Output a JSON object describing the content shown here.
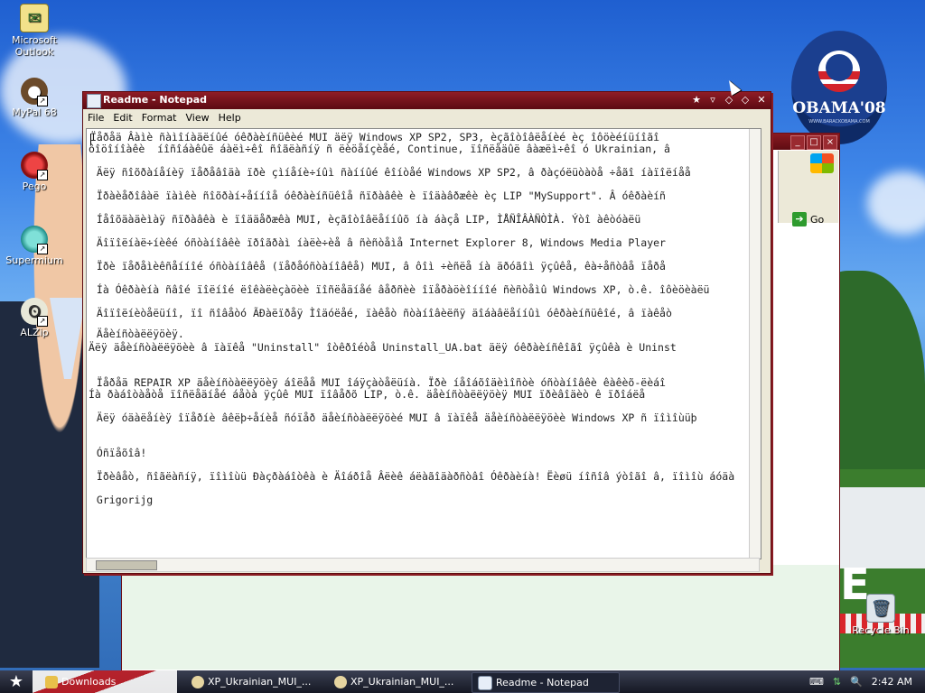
{
  "desktop": {
    "icons": [
      {
        "label_line1": "Microsoft",
        "label_line2": "Outlook"
      },
      {
        "label_line1": "MyPal 68",
        "label_line2": ""
      },
      {
        "label_line1": "Pego",
        "label_line2": ""
      },
      {
        "label_line1": "Supermium",
        "label_line2": ""
      },
      {
        "label_line1": "ALZip",
        "label_line2": ""
      }
    ],
    "recycle_bin": "Recycle Bin",
    "poster": {
      "text": "OBAMA'08",
      "subtitle": "WWW.BARACKOBAMA.COM"
    }
  },
  "notepad": {
    "title": "Readme - Notepad",
    "menu": [
      "File",
      "Edit",
      "Format",
      "View",
      "Help"
    ],
    "lines": [
      "Ïåðåä Âàìè ñàìîíàäëíûé óêðàèíñüêèé MUI äëÿ Windows XP SP2, SP3, èçãîòîâëåíèé èç îôöèéíüíîãî",
      "ôîöîíîàêè  íîñîáàêûë áàëì÷êî ñîãëàñíÿ ñ ëèöåíçèåé, Continue, ïîñëåäûë âàæëì÷êî ó Ukrainian, â",
      " Äëÿ ñîõðàíåíèÿ ïåðåâîäà ïðè çìíåíè÷íûì ñàííûé êîíòåé Windows XP SP2, â ðàçóëüòàòå ÷åãî íàïîëíåå",
      " Ïðàèåðîâàë ïàìêè ñîõðàí÷åííîå óêðàèíñüêîå ñïðàâêè è ïîäàâðæêè èç LIP \"MySupport\". Â óêðàèíñ",
      " Íåîõäàäèìàÿ ñïðàâêà è ïîääåðæêà MUI, èçãîòîâëåííûõ íà áàçå LIP, ÌÅÑÎÂÀÑÒÌÀ. Ýòî àêòóàëü",
      " Äîïîëíàë÷íèêé óñòàíîâêè ïðîãðàì íàëè÷èå â ñèñòåìå Internet Explorer 8, Windows Media Player",
      " Ïðè ïåðåìèêñåííîé óñòàíîâêå (ïåðåóñòàíîâêå) MUI, â ôîì ÷èñëå íà äðóãîì ÿçûêå, êà÷åñòâå ïåðå",
      " Íà Óêðàèíà ñâîé ïîëíîé ëîêàëèçàöèè ïîñëåäíåé âåðñèè îïåðàöèîííîé ñèñòåìû Windows XP, ò.ê. îôèöèàëü",
      " Äîïîëíèòåëüíî, ïî ñîâåòó ÃÐàëïðåÿ Ìîäóëåé, ïàêåò ñòàíîâèëñÿ äîáàâëåííûì óêðàèíñüêîé, â ïàêåò",
      " Äåèíñòàëëÿöèÿ.",
      "Äëÿ äåèíñòàëëÿöèè â ïàïêå \"Uninstall\" îòêðîéòå Uninstall_UA.bat äëÿ óêðàèíñêîãî ÿçûêà è Uninst",
      "",
      " Ïåðåä REPAIR XP äåèíñòàëëÿöèÿ áîëåå MUI îáÿçàòåëüíà. Ïðè íåîáõîäèìîñòè óñòàíîâêè êàêèõ-ëèáî",
      "Íà ðàáîòàåòå ïîñëåäíåé áåòà ÿçûê MUI ïîâåðõ LIP, ò.ê. äåèíñòàëëÿöèÿ MUI ïðèâîäèò ê ïðîáëå",
      " Äëÿ óäàëåíèÿ îïåðíè âêëþ÷åíèå ñóïåð äåèíñòàëëÿöèé MUI â ïàïêå äåèíñòàëëÿöèè Windows XP ñ ïîìîùüþ",
      "",
      " Óñïåõîâ!",
      "",
      " Ïðèâåò, ñîãëàñíÿ, ïîìîùü Ðàçðàáîòêà è Äîáðîå Âëèê áëàãîäàðñòâî Óêðàèíà! Ëèøü íîñîâ ýòîãî â, ïîìîù áóäà",
      "",
      " Grigorijg"
    ]
  },
  "background_window": {
    "go_label": "Go"
  },
  "taskbar": {
    "items": [
      {
        "label": "Downloads"
      },
      {
        "label": "XP_Ukrainian_MUI_..."
      },
      {
        "label": "XP_Ukrainian_MUI_..."
      },
      {
        "label": "Readme - Notepad"
      }
    ],
    "clock": "2:42 AM"
  }
}
